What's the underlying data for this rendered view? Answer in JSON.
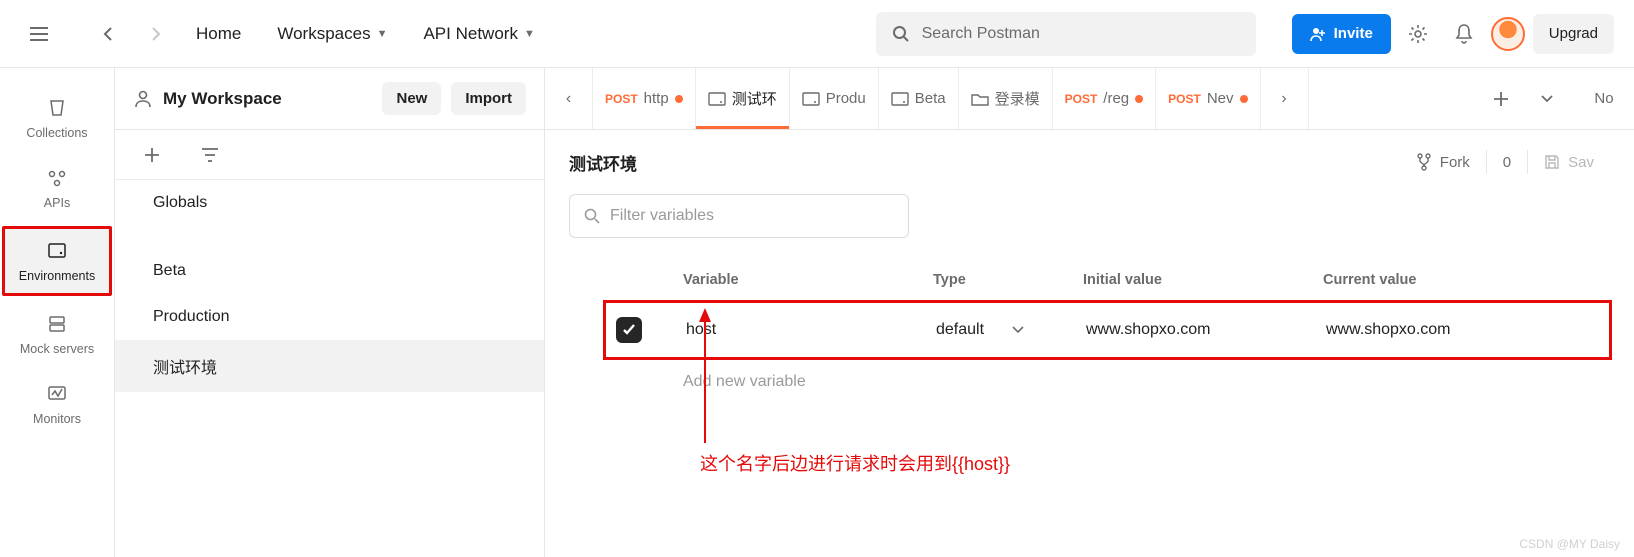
{
  "topnav": {
    "home": "Home",
    "workspaces": "Workspaces",
    "api_network": "API Network",
    "search_placeholder": "Search Postman",
    "invite": "Invite",
    "upgrade": "Upgrad"
  },
  "workspace": {
    "name": "My Workspace",
    "new_btn": "New",
    "import_btn": "Import"
  },
  "rail": {
    "collections": "Collections",
    "apis": "APIs",
    "environments": "Environments",
    "mock_servers": "Mock servers",
    "monitors": "Monitors"
  },
  "sidebar": {
    "globals": "Globals",
    "items": [
      "Beta",
      "Production",
      "测试环境"
    ]
  },
  "tabs": {
    "prev": "‹",
    "next": "›",
    "items": [
      {
        "method": "POST",
        "label": "http",
        "dirty": true
      },
      {
        "icon": "env",
        "label": "测试环",
        "active": true
      },
      {
        "icon": "env",
        "label": "Produ"
      },
      {
        "icon": "env",
        "label": "Beta"
      },
      {
        "icon": "folder",
        "label": "登录模"
      },
      {
        "method": "POST",
        "label": "/reg",
        "dirty": true
      },
      {
        "method": "POST",
        "label": "Nev",
        "dirty": true
      }
    ],
    "no_label": "No"
  },
  "env_panel": {
    "title": "测试环境",
    "fork": "Fork",
    "fork_count": "0",
    "save": "Sav",
    "filter_placeholder": "Filter variables",
    "columns": {
      "variable": "Variable",
      "type": "Type",
      "initial": "Initial value",
      "current": "Current value"
    },
    "row": {
      "variable": "host",
      "type": "default",
      "initial": "www.shopxo.com",
      "current": "www.shopxo.com"
    },
    "add_placeholder": "Add new variable"
  },
  "annotation": "这个名字后边进行请求时会用到{{host}}",
  "watermark": "CSDN @MY Daisy"
}
